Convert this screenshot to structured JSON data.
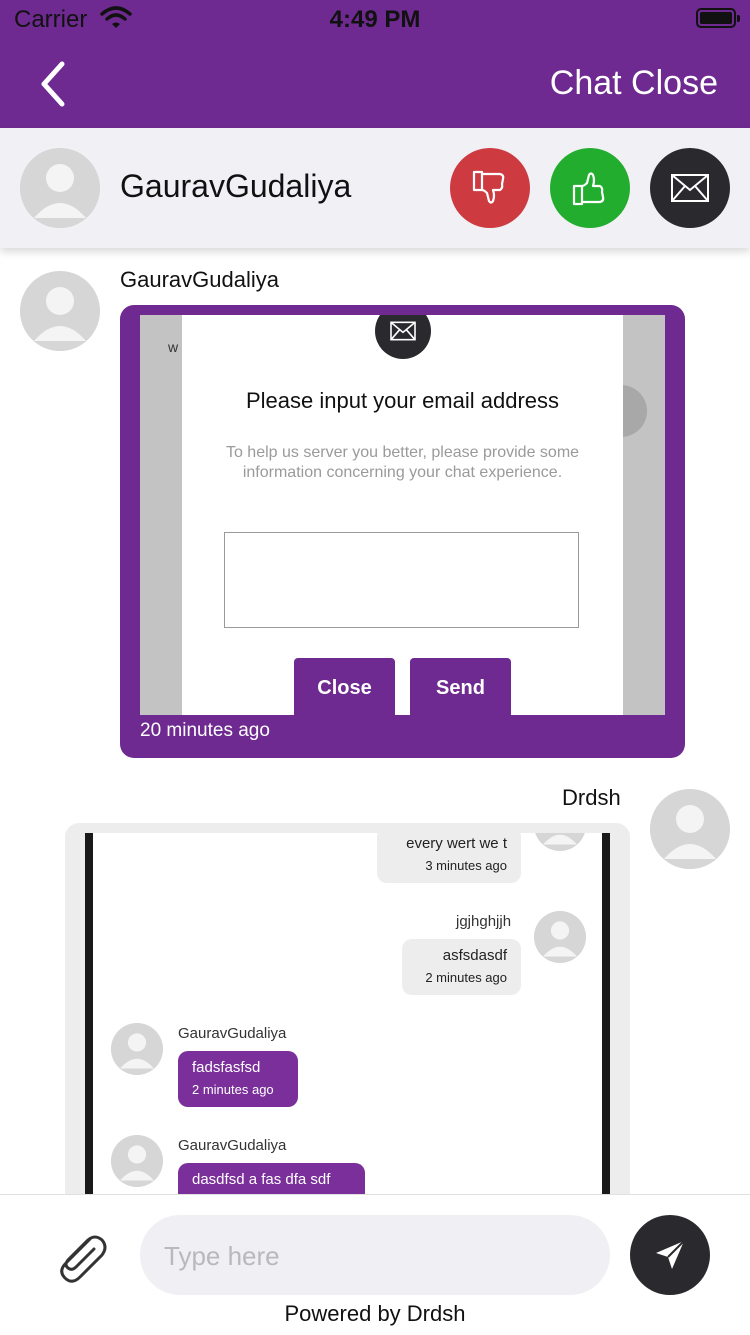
{
  "status_bar": {
    "carrier": "Carrier",
    "time": "4:49 PM"
  },
  "nav": {
    "back_icon": "chevron-left-icon",
    "title": "Chat Close"
  },
  "agent_header": {
    "name": "GauravGudaliya",
    "buttons": {
      "dislike": "thumbs-down-icon",
      "like": "thumbs-up-icon",
      "email": "envelope-icon"
    },
    "colors": {
      "dislike": "#cd3b41",
      "like": "#22ad2e",
      "email": "#2a2a2e"
    }
  },
  "messages": [
    {
      "sender": "GauravGudaliya",
      "direction": "incoming",
      "time": "20 minutes ago",
      "screenshot": {
        "partial_text": "w",
        "icon": "envelope-icon",
        "title": "Please input your email address",
        "description": "To help us server you better, please provide some information concerning your chat experience.",
        "close_label": "Close",
        "send_label": "Send"
      }
    },
    {
      "sender": "Drdsh",
      "direction": "outgoing",
      "screenshot": {
        "items": [
          {
            "text": "every wert we t",
            "time": "3 minutes ago"
          },
          {
            "name": "jgjhghjjh",
            "text": "asfsdasdf",
            "time": "2 minutes ago"
          },
          {
            "name": "GauravGudaliya",
            "text": "fadsfasfsd",
            "time": "2 minutes ago"
          },
          {
            "name": "GauravGudaliya",
            "text": "dasdfsd a fas dfa sdf"
          }
        ]
      }
    }
  ],
  "composer": {
    "attach_icon": "paperclip-icon",
    "placeholder": "Type here",
    "send_icon": "send-icon",
    "powered_by": "Powered by Drdsh"
  },
  "theme": {
    "primary": "#6e2a90",
    "dark": "#2a2a2e"
  }
}
